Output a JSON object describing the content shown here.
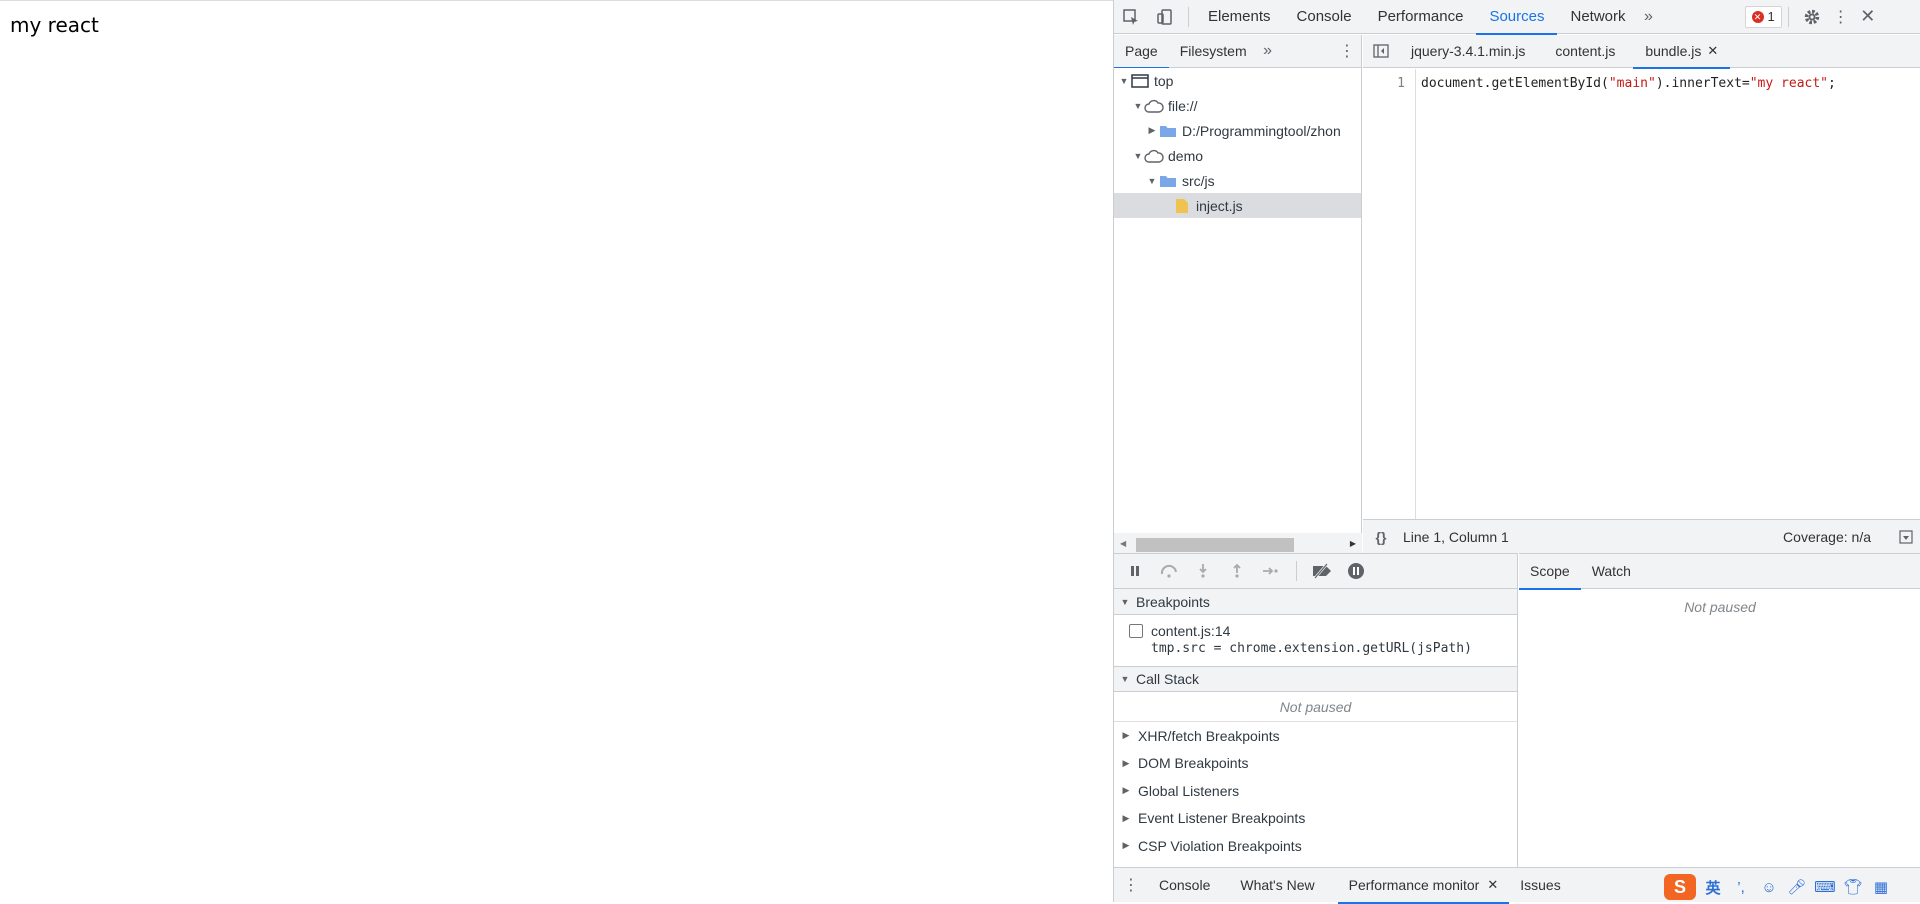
{
  "page": {
    "text": "my react"
  },
  "devtools": {
    "main_tabs": [
      "Elements",
      "Console",
      "Performance",
      "Sources",
      "Network"
    ],
    "active_main_tab": "Sources",
    "error_count": "1",
    "navigator": {
      "tabs": [
        "Page",
        "Filesystem"
      ],
      "tree": [
        {
          "label": "top",
          "icon": "frame-icon",
          "depth": 0,
          "expanded": true
        },
        {
          "label": "file://",
          "icon": "cloud-icon",
          "depth": 1,
          "expanded": true
        },
        {
          "label": "D:/Programmingtool/zhon",
          "icon": "folder-icon",
          "depth": 2,
          "expanded": false
        },
        {
          "label": "demo",
          "icon": "cloud-icon",
          "depth": 1,
          "expanded": true
        },
        {
          "label": "src/js",
          "icon": "folder-icon",
          "depth": 2,
          "expanded": true
        },
        {
          "label": "inject.js",
          "icon": "file-icon",
          "depth": 3,
          "selected": true
        }
      ]
    },
    "editor": {
      "tabs": [
        "jquery-3.4.1.min.js",
        "content.js",
        "bundle.js"
      ],
      "active_tab": "bundle.js",
      "line_number": "1",
      "code": {
        "part1": "document.getElementById(",
        "str1": "\"main\"",
        "part2": ").innerText=",
        "str2": "\"my react\"",
        "part3": ";"
      },
      "status": {
        "format_icon": "{}",
        "position": "Line 1, Column 1",
        "coverage": "Coverage: n/a"
      }
    },
    "debugger": {
      "breakpoints_label": "Breakpoints",
      "breakpoint_file": "content.js:14",
      "breakpoint_code": "tmp.src = chrome.extension.getURL(jsPath)",
      "call_stack_label": "Call Stack",
      "not_paused": "Not paused",
      "collapsed_sections": [
        "XHR/fetch Breakpoints",
        "DOM Breakpoints",
        "Global Listeners",
        "Event Listener Breakpoints",
        "CSP Violation Breakpoints"
      ]
    },
    "scope": {
      "tabs": [
        "Scope",
        "Watch"
      ],
      "not_paused": "Not paused"
    },
    "drawer": {
      "tabs": [
        "Console",
        "What's New",
        "Performance monitor",
        "Issues"
      ],
      "active_tab": "Performance monitor"
    }
  },
  "ime": {
    "lang": "英"
  },
  "colors": {
    "accent": "#1a73e8",
    "error": "#d93025",
    "string": "#c41a16"
  }
}
